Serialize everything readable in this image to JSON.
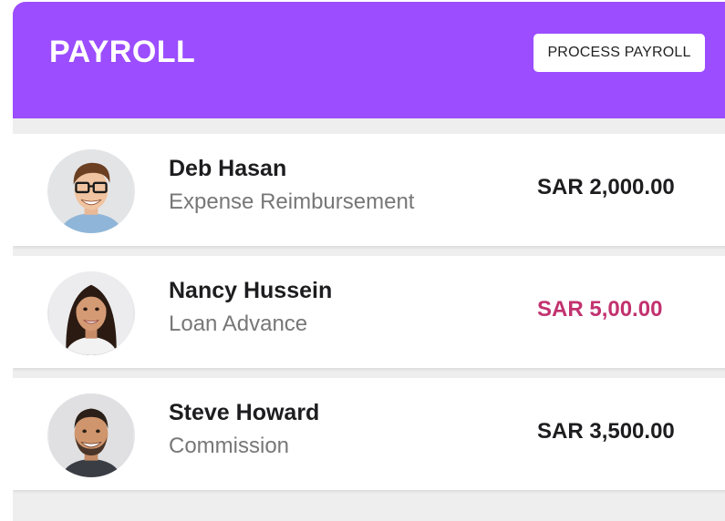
{
  "header": {
    "title": "PAYROLL",
    "action_label": "PROCESS PAYROLL",
    "color": "#9b4dff"
  },
  "employees": [
    {
      "name": "Deb Hasan",
      "description": "Expense Reimbursement",
      "amount": "SAR 2,000.00",
      "amount_color": "#1d1d1f",
      "avatar": "avatar-man-glasses"
    },
    {
      "name": "Nancy Hussein",
      "description": "Loan Advance",
      "amount": "SAR 5,00.00",
      "amount_color": "#c2326f",
      "avatar": "avatar-woman"
    },
    {
      "name": "Steve Howard",
      "description": "Commission",
      "amount": "SAR 3,500.00",
      "amount_color": "#1d1d1f",
      "avatar": "avatar-man-beard"
    }
  ]
}
